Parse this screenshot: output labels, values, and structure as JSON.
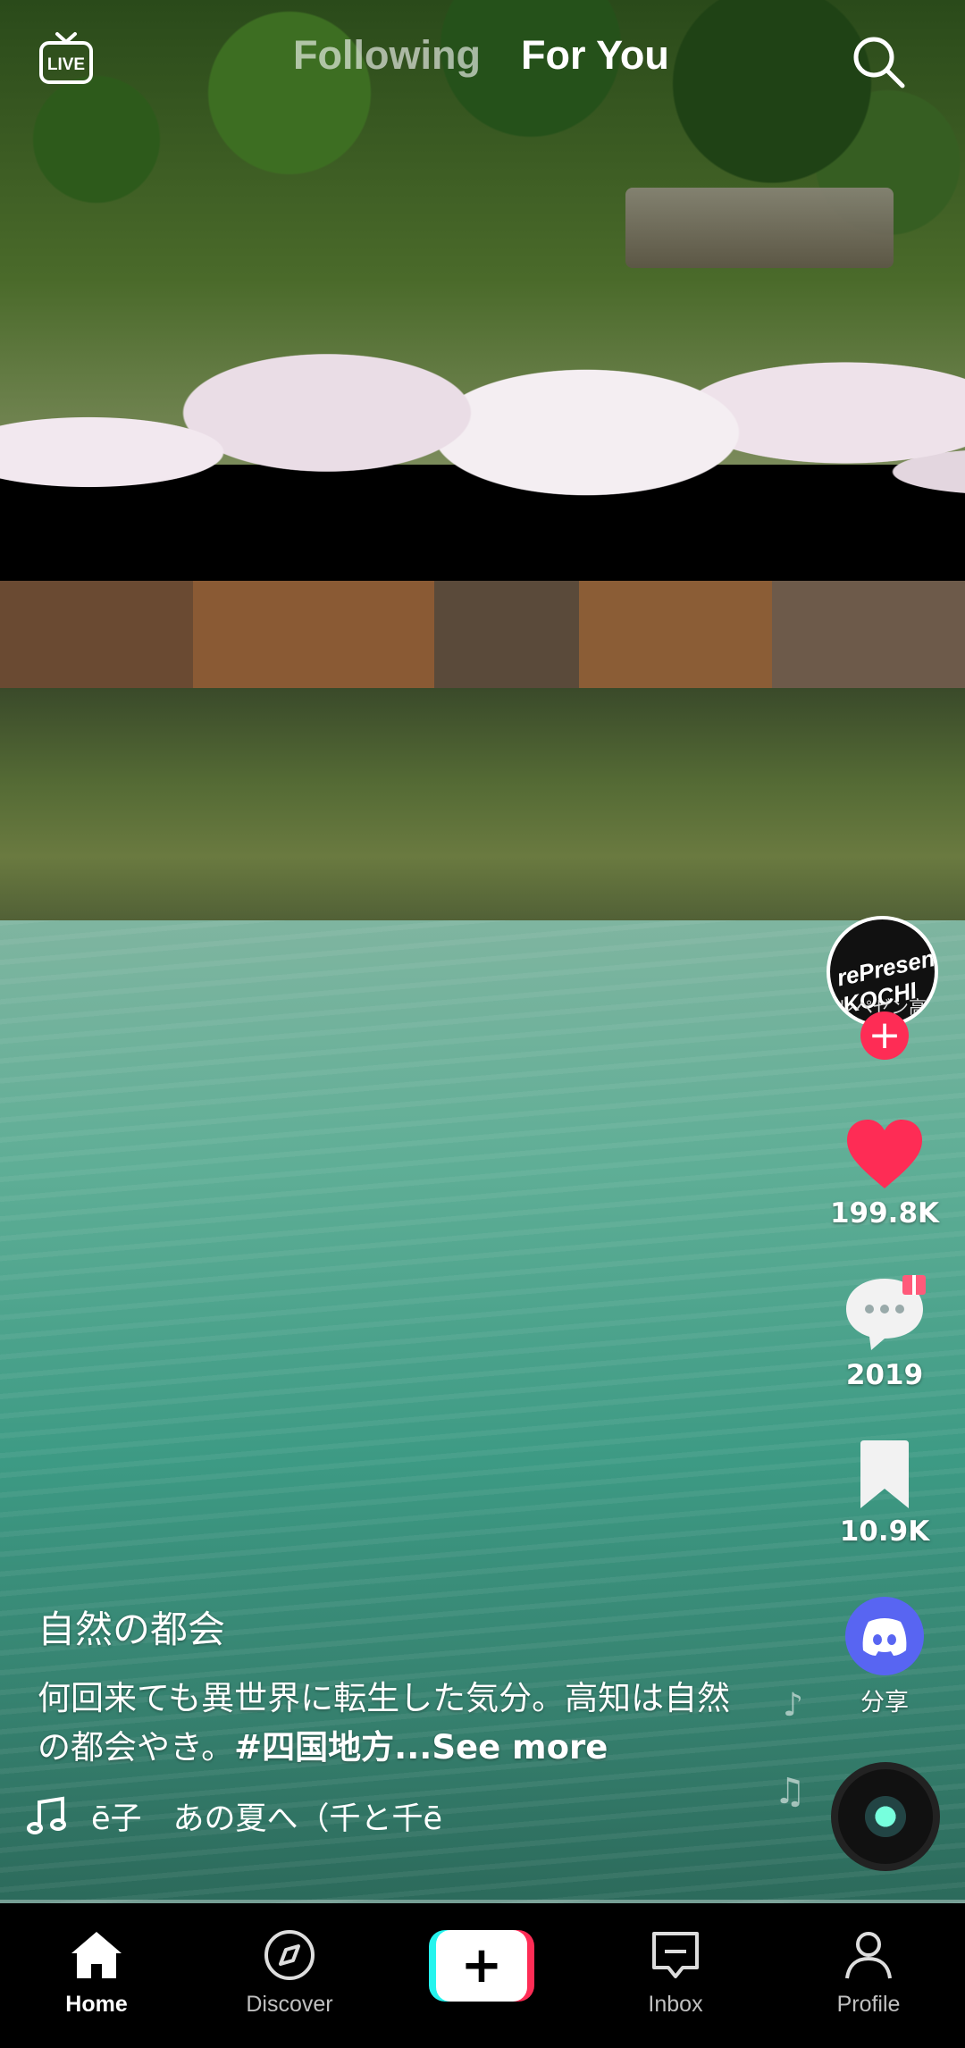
{
  "top": {
    "live_label": "LIVE",
    "tabs": [
      {
        "label": "Following"
      },
      {
        "label": "For You"
      }
    ]
  },
  "video": {
    "author_avatar_text": "rePresent KOCHI",
    "author_avatar_sub": "レペゼン高知",
    "likes": "199.8K",
    "comments": "2019",
    "saves": "10.9K",
    "share_label": "分享",
    "username": "自然の都会",
    "description": "何回来ても異世界に転生した気分。高知は自然の都会やき。",
    "hashtag": "#四国地方",
    "see_more": "...See more",
    "music": "ē子　あの夏へ（千と千ē"
  },
  "colors": {
    "accent_red": "#fe2c55",
    "accent_cyan": "#25f4ee",
    "discord_blue": "#5865f2"
  },
  "nav": {
    "home": "Home",
    "discover": "Discover",
    "inbox": "Inbox",
    "profile": "Profile"
  }
}
